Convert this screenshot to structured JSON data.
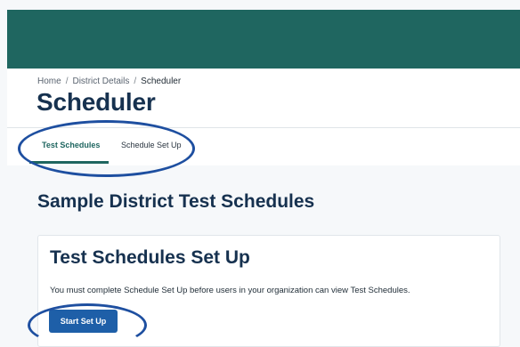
{
  "header": {
    "breadcrumb": {
      "home": "Home",
      "sep1": "/",
      "district": "District Details",
      "sep2": "/",
      "current": "Scheduler"
    },
    "title": "Scheduler"
  },
  "tabs": [
    {
      "label": "Test Schedules",
      "active": true
    },
    {
      "label": "Schedule Set Up",
      "active": false
    }
  ],
  "main": {
    "section_title": "Sample District Test Schedules",
    "card": {
      "title": "Test Schedules Set Up",
      "message": "You must complete Schedule Set Up before users in your organization can view Test Schedules.",
      "button_label": "Start Set Up"
    }
  },
  "colors": {
    "topbar": "#1f6660",
    "accent": "#1f6660",
    "button": "#1e5fa8",
    "annotation": "#1e4fa0"
  }
}
